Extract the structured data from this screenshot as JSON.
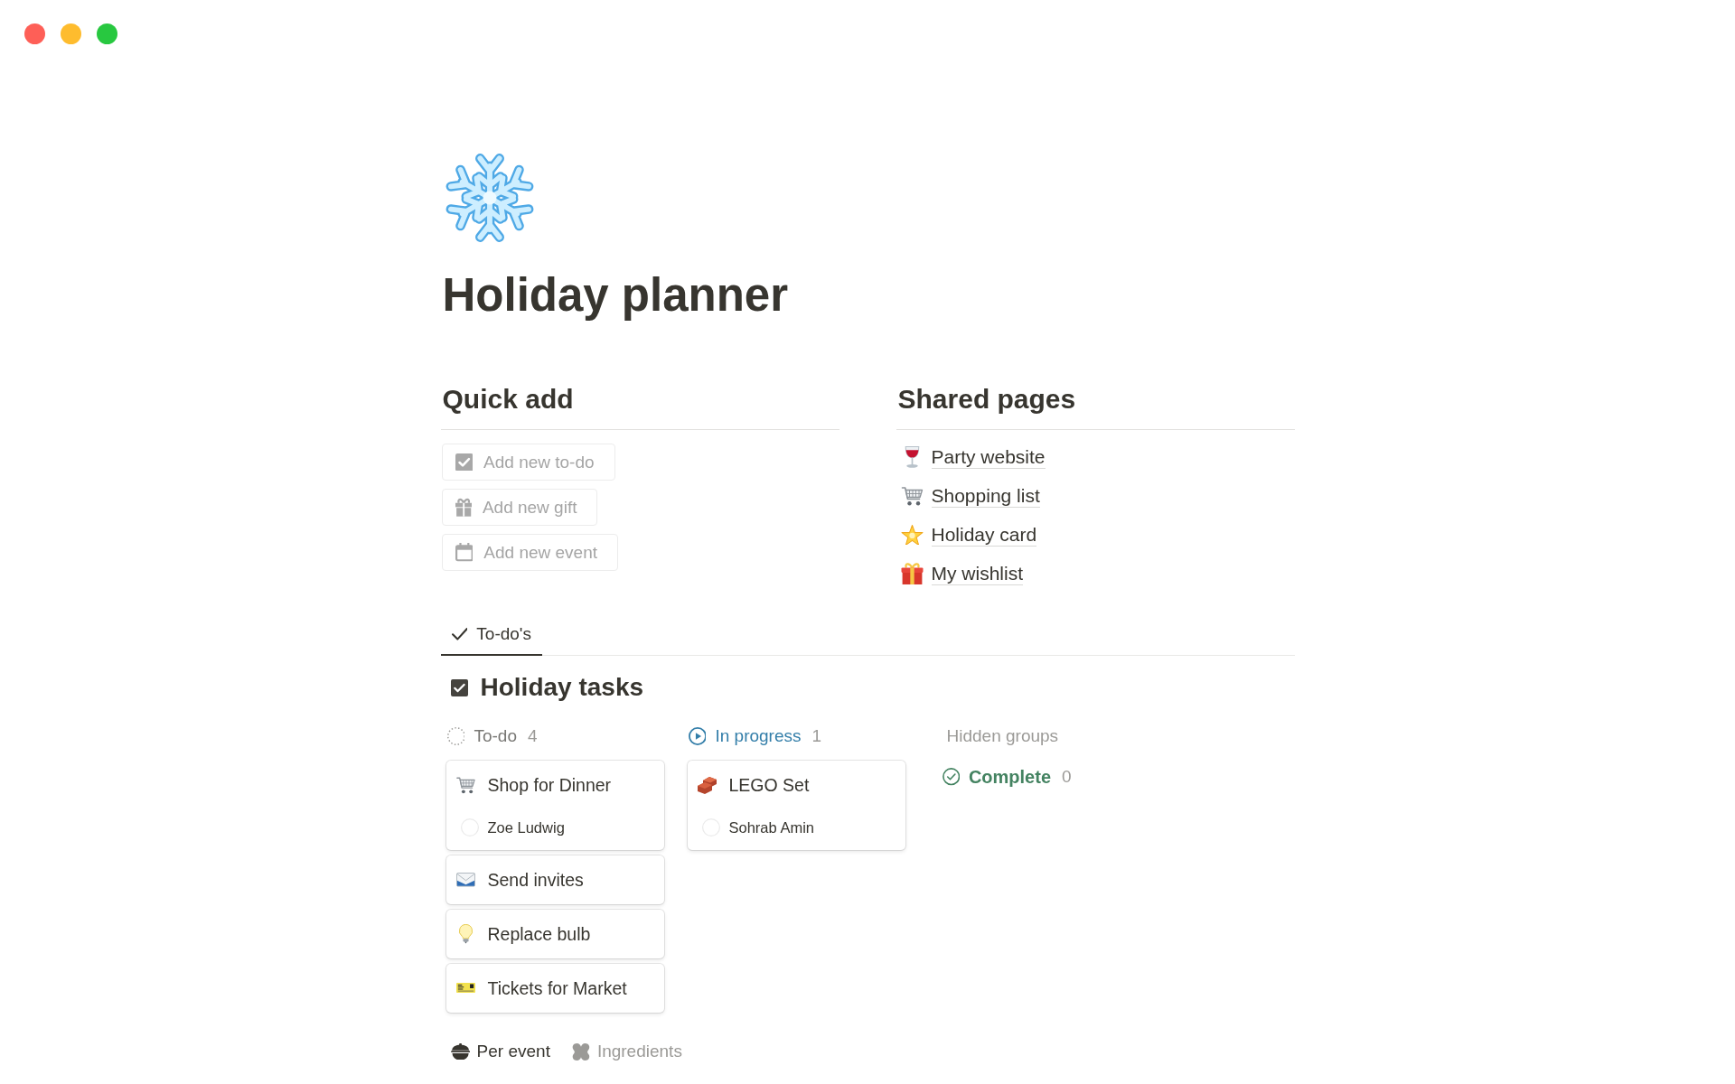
{
  "window_controls": [
    {
      "kind": "close"
    },
    {
      "kind": "minimize"
    },
    {
      "kind": "zoom"
    }
  ],
  "page": {
    "title": "Holiday planner"
  },
  "quick_add": {
    "heading": "Quick add",
    "buttons": [
      {
        "kind": "todo",
        "label": "Add new to-do"
      },
      {
        "kind": "gift",
        "label": "Add new gift"
      },
      {
        "kind": "event",
        "label": "Add new event"
      }
    ]
  },
  "shared_pages": {
    "heading": "Shared pages",
    "links": [
      {
        "kind": "wine",
        "label": "Party website"
      },
      {
        "kind": "cart",
        "label": "Shopping list"
      },
      {
        "kind": "star",
        "label": "Holiday card"
      },
      {
        "kind": "gift",
        "label": "My wishlist"
      }
    ]
  },
  "view_tabs": [
    {
      "label": "To-do's",
      "selected": true
    }
  ],
  "board": {
    "title": "Holiday tasks",
    "groups": [
      {
        "kind": "todo",
        "label": "To-do",
        "count": "4",
        "cards": [
          {
            "kind": "cart",
            "title": "Shop for Dinner",
            "assignee": "Zoe Ludwig"
          },
          {
            "kind": "envelope",
            "title": "Send invites"
          },
          {
            "kind": "bulb",
            "title": "Replace bulb"
          },
          {
            "kind": "ticket",
            "title": "Tickets for Market"
          }
        ]
      },
      {
        "kind": "progress",
        "label": "In progress",
        "count": "1",
        "cards": [
          {
            "kind": "bricks",
            "title": "LEGO Set",
            "assignee": "Sohrab Amin"
          }
        ]
      }
    ],
    "hidden_groups": {
      "label": "Hidden groups",
      "groups": [
        {
          "kind": "complete",
          "label": "Complete",
          "count": "0"
        }
      ]
    }
  },
  "bottom_tabs": [
    {
      "kind": "bowl",
      "label": "Per event",
      "selected": true
    },
    {
      "kind": "ingredients",
      "label": "Ingredients",
      "selected": false
    }
  ]
}
